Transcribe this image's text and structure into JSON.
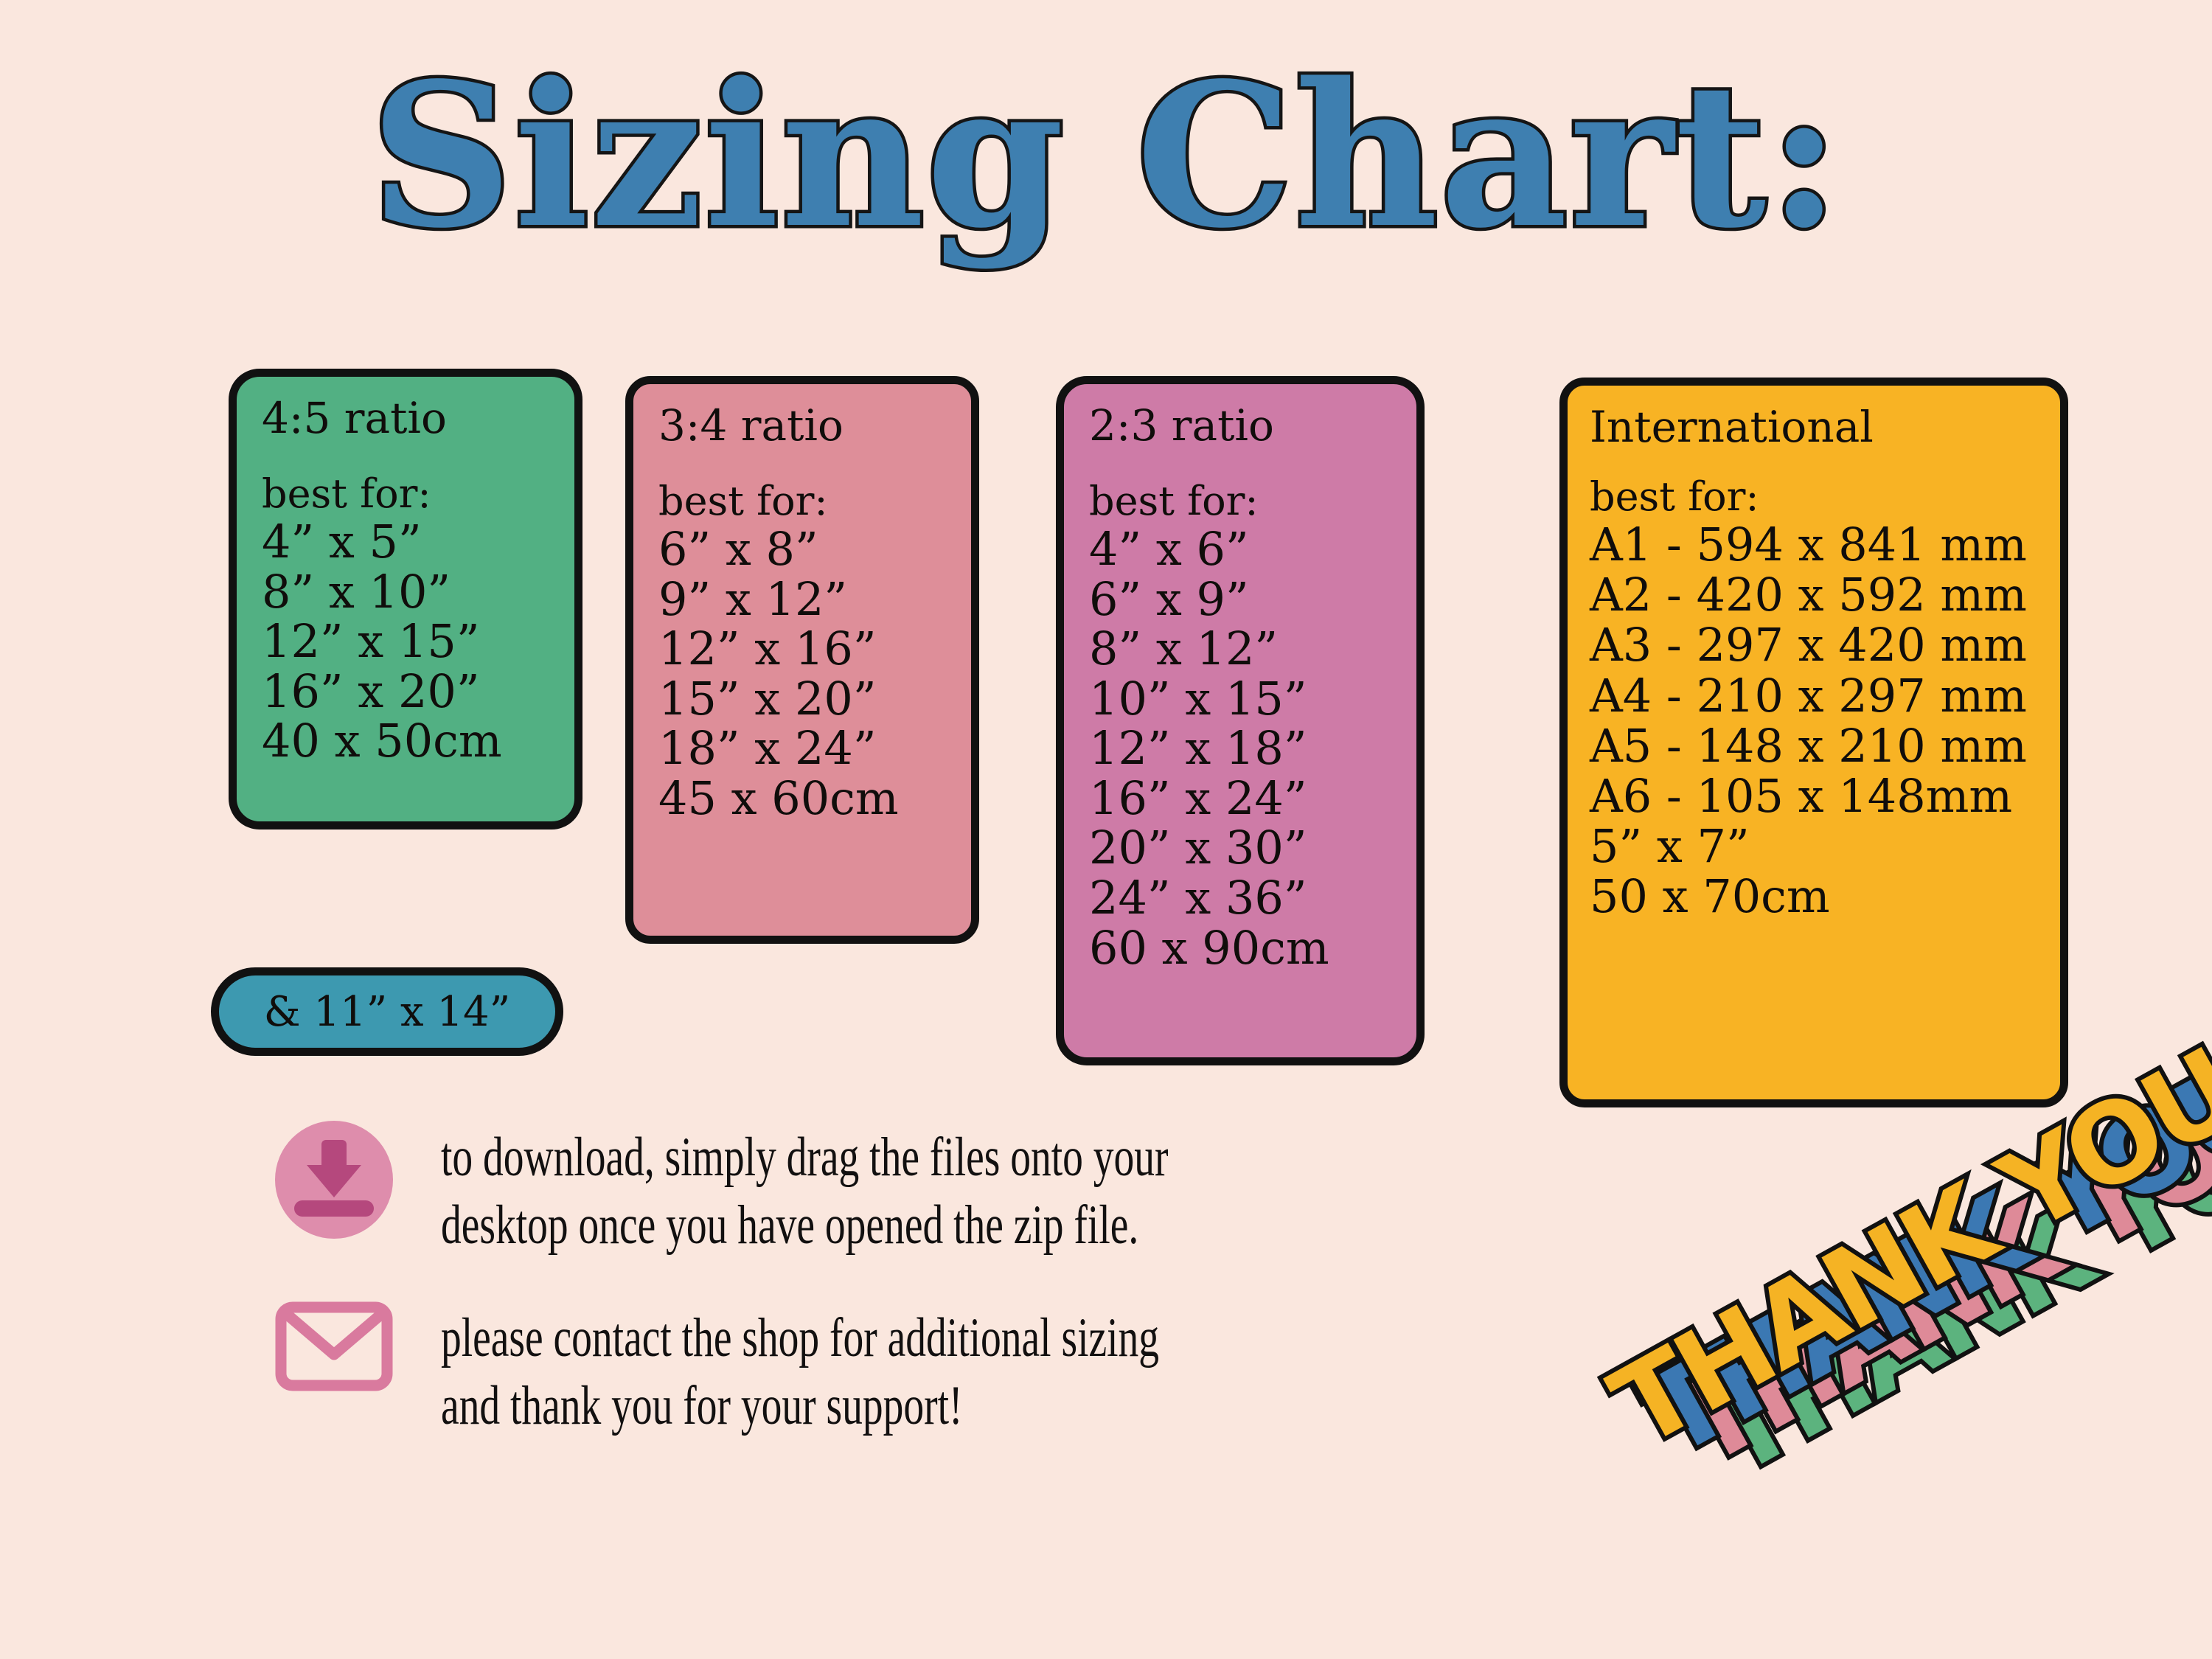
{
  "page": {
    "title": "Sizing Chart:",
    "background_color": "#FAE7DE",
    "title_color": "#3E7FB0",
    "outline_color": "#111111"
  },
  "cards": [
    {
      "id": "ratio-4-5",
      "ratio": "4:5 ratio",
      "best_for_label": "best for:",
      "color": "#52B083",
      "sizes": [
        "4” x 5”",
        "8” x 10”",
        "12” x 15”",
        "16” x 20”",
        "40 x 50cm"
      ]
    },
    {
      "id": "ratio-3-4",
      "ratio": "3:4 ratio",
      "best_for_label": "best for:",
      "color": "#DE8E99",
      "sizes": [
        "6” x 8”",
        "9” x 12”",
        "12” x 16”",
        "15” x 20”",
        "18” x 24”",
        "45 x 60cm"
      ]
    },
    {
      "id": "ratio-2-3",
      "ratio": "2:3 ratio",
      "best_for_label": "best for:",
      "color": "#CE7BA7",
      "sizes": [
        "4” x 6”",
        "6” x 9”",
        "8” x 12”",
        "10” x 15”",
        "12” x 18”",
        "16” x 24”",
        "20” x 30”",
        "24” x 36”",
        "60 x 90cm"
      ]
    },
    {
      "id": "international",
      "ratio": "International",
      "best_for_label": "best for:",
      "color": "#F8B324",
      "sizes": [
        "A1 - 594 x 841 mm",
        "A2 - 420 x 592 mm",
        "A3 - 297 x 420 mm",
        "A4 - 210 x 297 mm",
        "A5 - 148 x 210 mm",
        "A6 - 105 x 148mm",
        "5” x 7”",
        "50 x 70cm"
      ]
    }
  ],
  "extra_size_pill": {
    "label": "& 11” x 14”",
    "color": "#3D99B0"
  },
  "notes": [
    {
      "icon": "download-icon",
      "icon_circle_color": "#DE8DAC",
      "icon_arrow_color": "#B5487D",
      "line1": "to download, simply drag the files onto your",
      "line2": "desktop once you have opened the zip file."
    },
    {
      "icon": "envelope-icon",
      "icon_color": "#D97A9E",
      "line1": "please contact the shop for additional sizing",
      "line2": "and thank you for your support!"
    }
  ],
  "thank_you_badge": {
    "text": "THANK YOU",
    "layers": [
      {
        "label": "THANK YOU",
        "color": "#F5B324"
      },
      {
        "label": "THANK YOU",
        "color": "#3B78B3"
      },
      {
        "label": "THANK YOU",
        "color": "#DE8A98"
      },
      {
        "label": "THANK YOU",
        "color": "#5CB37E"
      }
    ]
  }
}
